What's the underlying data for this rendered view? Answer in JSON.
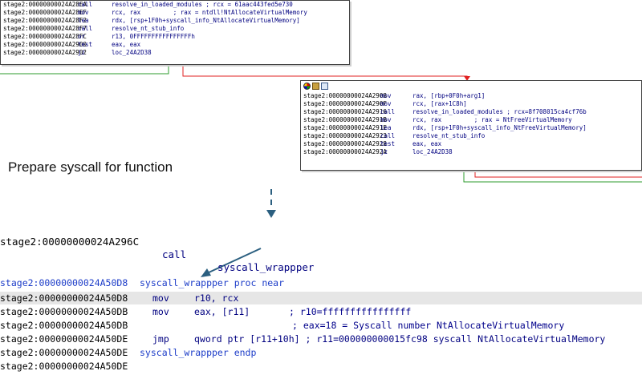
{
  "top_block": {
    "lines": [
      {
        "addr": "stage2:00000000024A28EA",
        "mn": "call",
        "op": "resolve_in_loaded_modules ; rcx = 61aac443fed5e730"
      },
      {
        "addr": "stage2:00000000024A28EF",
        "mn": "mov",
        "op": "rcx, rax         ; rax = ntdll!NtAllocateVirtualMemory"
      },
      {
        "addr": "stage2:00000000024A28F2",
        "mn": "lea",
        "op": "rdx, [rsp+1F0h+syscall_info_NtAllocateVirtualMemory]"
      },
      {
        "addr": "stage2:00000000024A28F7",
        "mn": "call",
        "op": "resolve_nt_stub_info"
      },
      {
        "addr": "stage2:00000000024A28FC",
        "mn": "or",
        "op": "r13, 0FFFFFFFFFFFFFFFFh"
      },
      {
        "addr": "stage2:00000000024A2900",
        "mn": "test",
        "op": "eax, eax"
      },
      {
        "addr": "stage2:00000000024A2902",
        "mn": "jz",
        "op": "loc_24A2D38"
      }
    ]
  },
  "second_block": {
    "toolbar_icons": [
      "color-icon",
      "edit-icon",
      "group-icon"
    ],
    "lines": [
      {
        "addr": "stage2:00000000024A2908",
        "mn": "mov",
        "op": "rax, [rbp+0F0h+arg1]"
      },
      {
        "addr": "stage2:00000000024A290F",
        "mn": "mov",
        "op": "rcx, [rax+1C8h]"
      },
      {
        "addr": "stage2:00000000024A2916",
        "mn": "call",
        "op": "resolve_in_loaded_modules ; rcx=8f708015ca4cf76b"
      },
      {
        "addr": "stage2:00000000024A291B",
        "mn": "mov",
        "op": "rcx, rax         ; rax = NtFreeVirtualMemory"
      },
      {
        "addr": "stage2:00000000024A291E",
        "mn": "lea",
        "op": "rdx, [rsp+1F0h+syscall_info_NtFreeVirtualMemory]"
      },
      {
        "addr": "stage2:00000000024A2923",
        "mn": "call",
        "op": "resolve_nt_stub_info"
      },
      {
        "addr": "stage2:00000000024A2928",
        "mn": "test",
        "op": "eax, eax"
      },
      {
        "addr": "stage2:00000000024A292A",
        "mn": "jz",
        "op": "loc_24A2D38"
      }
    ]
  },
  "caption": "Prepare syscall for function",
  "call_line": {
    "addr": "stage2:00000000024A296C",
    "mn": "call",
    "op": "syscall_wrappper"
  },
  "listing": {
    "lines": [
      {
        "addr": "stage2:00000000024A50D8",
        "label": "syscall_wrappper proc near"
      },
      {
        "addr": "stage2:00000000024A50D8",
        "mn": "mov",
        "op": "r10, rcx"
      },
      {
        "addr": "stage2:00000000024A50DB",
        "mn": "mov",
        "op": "eax, [r11]",
        "comment": "; r10=ffffffffffffffff"
      },
      {
        "addr": "stage2:00000000024A50DB",
        "comment": "; eax=18 = Syscall number NtAllocateVirtualMemory"
      },
      {
        "addr": "stage2:00000000024A50DE",
        "mn": "jmp",
        "op": "qword ptr [r11+10h] ; r11=000000000015fc98 syscall NtAllocateVirtualMemory"
      },
      {
        "addr": "stage2:00000000024A50DE",
        "label": "syscall_wrappper endp"
      },
      {
        "addr": "stage2:00000000024A50DE"
      }
    ]
  },
  "colors": {
    "edge_green": "#2e9b2e",
    "edge_red": "#e02020",
    "arrow_blue": "#2b5f80",
    "highlight": "#e6e6e6"
  }
}
